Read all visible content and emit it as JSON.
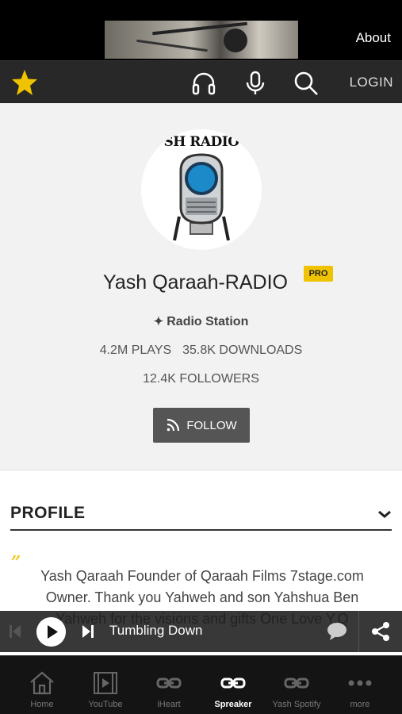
{
  "banner": {
    "about_label": "About"
  },
  "navbar": {
    "login_label": "LOGIN",
    "accent_color": "#f0c300"
  },
  "station": {
    "avatar_text": "SH RADIO",
    "name": "Yash Qaraah-RADIO",
    "badge": "PRO",
    "category": "Radio Station",
    "plays": "4.2M PLAYS",
    "downloads": "35.8K DOWNLOADS",
    "followers": "12.4K FOLLOWERS",
    "follow_label": "FOLLOW"
  },
  "profile": {
    "heading": "PROFILE",
    "quote_mark": "”",
    "bio": "Yash Qaraah Founder of Qaraah Films 7stage.com Owner. Thank you Yahweh and son Yahshua Ben Yahweh for the visions and gifts One Love Y.Q"
  },
  "player": {
    "track_title": "Tumbling Down"
  },
  "tabs": [
    {
      "label": "Home",
      "icon": "home-icon"
    },
    {
      "label": "YouTube",
      "icon": "video-icon"
    },
    {
      "label": "iHeart",
      "icon": "link-icon"
    },
    {
      "label": "Spreaker",
      "icon": "link-icon",
      "active": true
    },
    {
      "label": "Yash Spotify",
      "icon": "link-icon"
    },
    {
      "label": "more",
      "icon": "more-icon"
    }
  ]
}
